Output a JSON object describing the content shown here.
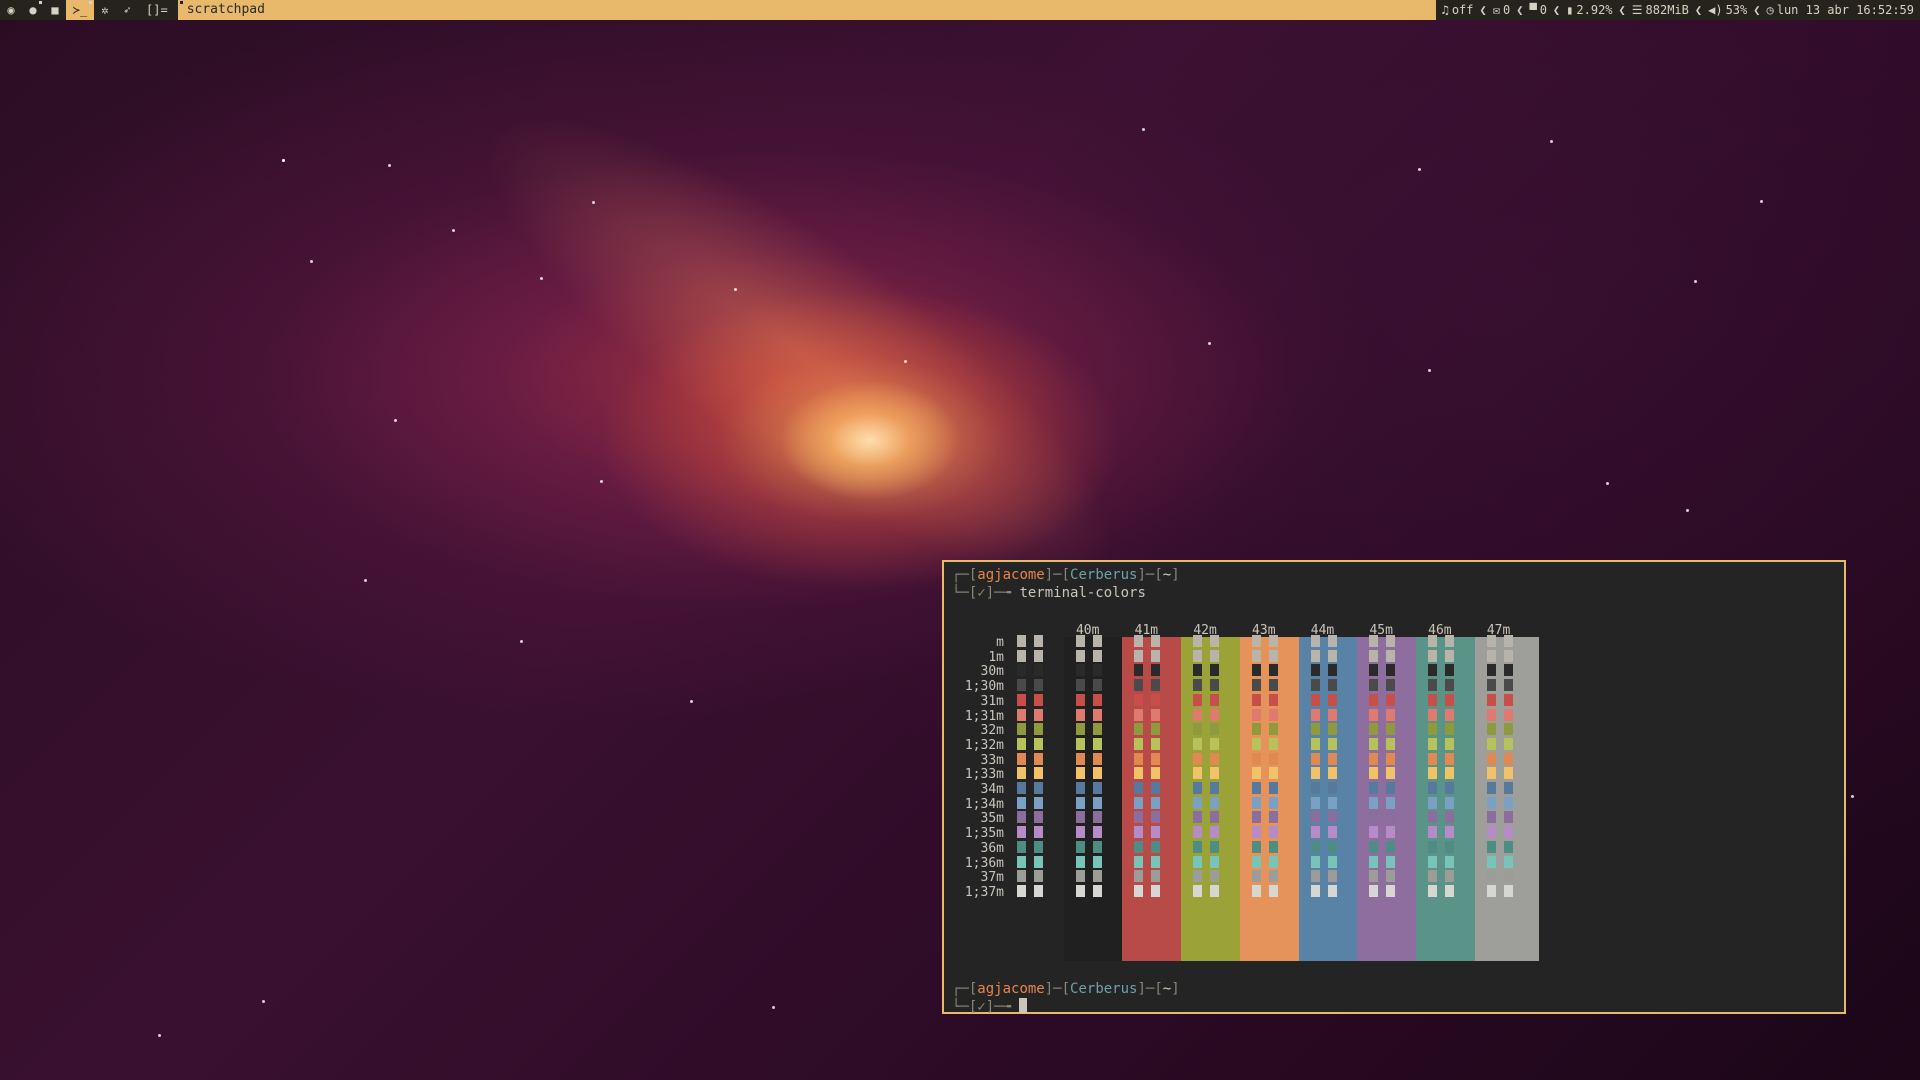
{
  "topbar": {
    "workspaces": [
      {
        "icon": "globe-icon",
        "glyph": "◉",
        "active": false,
        "marker": false
      },
      {
        "icon": "chat-icon",
        "glyph": "●",
        "active": false,
        "marker": true
      },
      {
        "icon": "video-icon",
        "glyph": "■",
        "active": false,
        "marker": false
      },
      {
        "icon": "terminal-icon",
        "glyph": "≻_",
        "active": true,
        "marker": true
      },
      {
        "icon": "gear-icon",
        "glyph": "✲",
        "active": false,
        "marker": false
      },
      {
        "icon": "rocket-icon",
        "glyph": "➶",
        "active": false,
        "marker": false
      }
    ],
    "layout_symbol": "[]=",
    "window_title": "scratchpad",
    "status": [
      {
        "icon": "music-icon",
        "glyph": "♫",
        "text": "off"
      },
      {
        "icon": "mail-icon",
        "glyph": "✉",
        "text": "0"
      },
      {
        "icon": "trash-icon",
        "glyph": "▀",
        "text": "0"
      },
      {
        "icon": "cpu-icon",
        "glyph": "▮",
        "text": "2.92%"
      },
      {
        "icon": "memory-icon",
        "glyph": "☰",
        "text": "882MiB"
      },
      {
        "icon": "volume-icon",
        "glyph": "◀)",
        "text": "53%"
      },
      {
        "icon": "clock-icon",
        "glyph": "◷",
        "text": "lun 13 abr 16:52:59"
      }
    ]
  },
  "terminal": {
    "prompt1": {
      "corner": "┌─[",
      "user": "agjacome",
      "mid": "]─[",
      "host": "Cerberus",
      "mid2": "]─[",
      "dir": "~",
      "end": "]"
    },
    "line2": {
      "prefix": "└─[✓]─╼ ",
      "command": "terminal-colors"
    },
    "prompt2": {
      "corner": "┌─[",
      "user": "agjacome",
      "mid": "]─[",
      "host": "Cerberus",
      "mid2": "]─[",
      "dir": "~",
      "end": "]"
    },
    "line4": {
      "prefix": "└─[✓]─╼ "
    },
    "column_headers": [
      "40m",
      "41m",
      "42m",
      "43m",
      "44m",
      "45m",
      "46m",
      "47m"
    ],
    "row_labels": [
      "m",
      "1m",
      "30m",
      "1;30m",
      "31m",
      "1;31m",
      "32m",
      "1;32m",
      "33m",
      "1;33m",
      "34m",
      "1;34m",
      "35m",
      "1;35m",
      "36m",
      "1;36m",
      "37m",
      "1;37m"
    ],
    "palette": {
      "bg": [
        "#202020",
        "#b84a48",
        "#9aa238",
        "#e5935a",
        "#5882a6",
        "#8e6e9f",
        "#5a9488",
        "#9e9e9a"
      ],
      "fg": [
        "#b8b4aa",
        "#b8b4aa",
        "#2a2a2a",
        "#4a4a4a",
        "#c84e4a",
        "#e07a70",
        "#8e9a3c",
        "#b7c25a",
        "#e08a52",
        "#f2c268",
        "#56799c",
        "#7aa0c4",
        "#8c6e9e",
        "#b68cc8",
        "#4e8c84",
        "#78c4b8",
        "#9c9c98",
        "#d6d6d2"
      ]
    }
  }
}
